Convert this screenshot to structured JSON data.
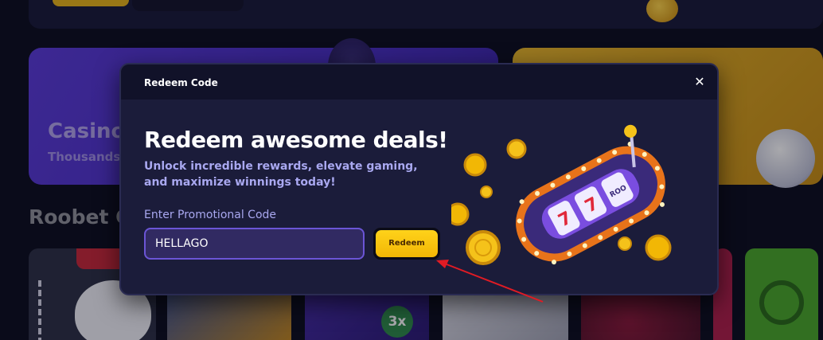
{
  "background": {
    "casino_card": {
      "title": "Casino",
      "subtitle": "Thousands"
    },
    "section_title": "Roobet C",
    "tile_badge": "3x"
  },
  "modal": {
    "title": "Redeem Code",
    "close_symbol": "✕",
    "headline": "Redeem awesome deals!",
    "subtitle": "Unlock incredible rewards, elevate gaming, and maximize winnings today!",
    "promo_label": "Enter Promotional Code",
    "promo_input_value": "HELLAGO",
    "redeem_button_label": "Redeem"
  },
  "colors": {
    "page_bg": "#0d0e20",
    "modal_bg": "#1b1c3a",
    "accent_yellow": "#ffd21a",
    "input_border": "#6b55d6",
    "text_muted": "#a9a8f0",
    "annotation_arrow": "#e01b24"
  },
  "icons": {
    "close": "close-icon",
    "illustration": "slot-machine-illustration",
    "coins": "coin-icon"
  }
}
